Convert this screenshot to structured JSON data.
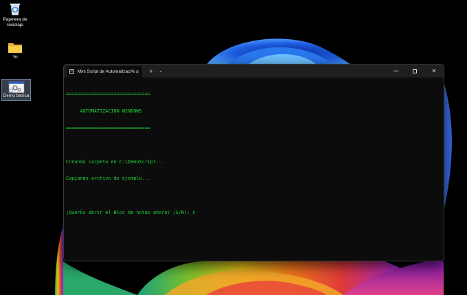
{
  "desktop": {
    "icons": [
      {
        "label": "Papelera de reciclaje",
        "icon": "recycle-bin-icon"
      },
      {
        "label": "Yo",
        "icon": "folder-icon"
      },
      {
        "label": "Demo basica",
        "icon": "shortcut-gear-icon"
      }
    ]
  },
  "terminal": {
    "tab_title": "Mini Script de Automatizaci%",
    "tab_close": "✕",
    "new_tab": "+",
    "dropdown": "⌄",
    "controls": {
      "close": "✕"
    },
    "lines": [
      "==============================",
      "     AUTOMATIZACION WINDOWS",
      "==============================",
      "",
      "Creando carpeta en C:\\DemoScript...",
      "Copiando archivo de ejemplo...",
      "",
      "¡QuerÚs abrir el Bloc de notas ahora? (S/N): s"
    ],
    "text_color": "#1edb3a"
  }
}
